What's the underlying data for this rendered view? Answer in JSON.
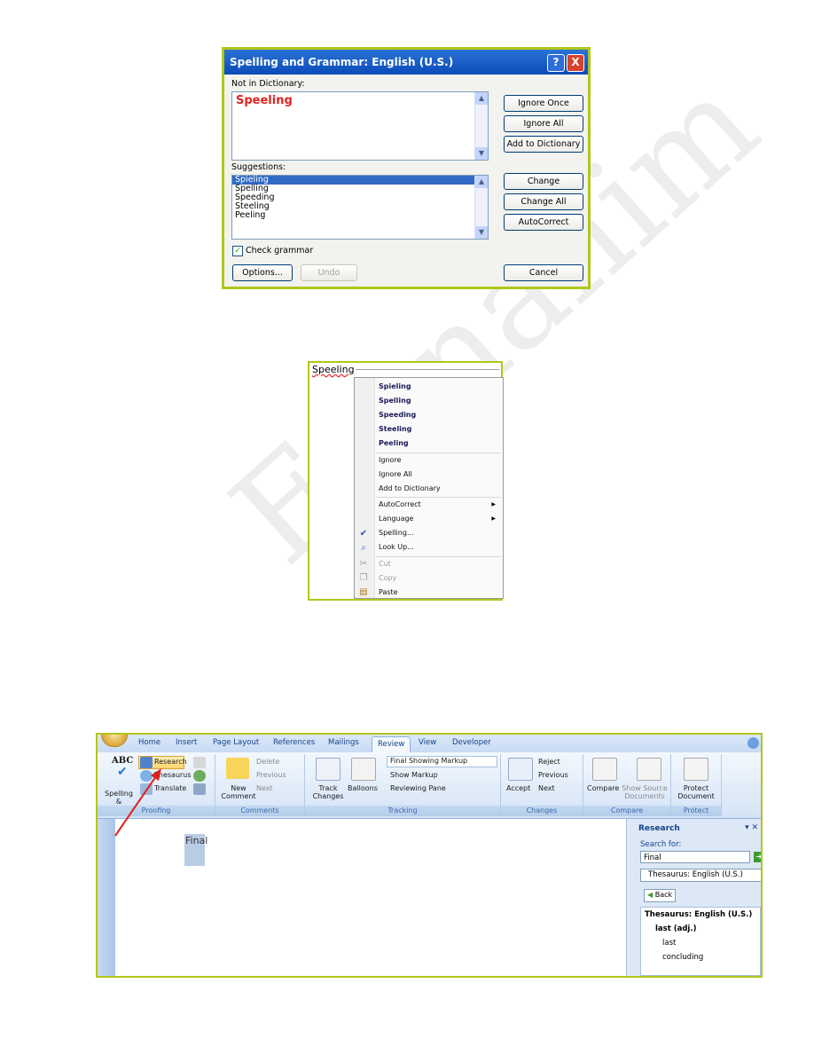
{
  "watermark": "Farnani​m",
  "dialog": {
    "title": "Spelling and Grammar: English (U.S.)",
    "help_icon": "?",
    "close_icon": "X",
    "not_in_dictionary_label": "Not in Dictionary:",
    "not_in_dictionary_word": "Speeling",
    "suggestions_label": "Suggestions:",
    "suggestions": [
      "Spieling",
      "Spelling",
      "Speeding",
      "Steeling",
      "Peeling"
    ],
    "buttons": {
      "ignore_once": "Ignore Once",
      "ignore_all": "Ignore All",
      "add_to_dictionary": "Add to Dictionary",
      "change": "Change",
      "change_all": "Change All",
      "autocorrect": "AutoCorrect",
      "options": "Options...",
      "undo": "Undo",
      "cancel": "Cancel"
    },
    "check_grammar_label": "Check grammar",
    "check_grammar_checked": true
  },
  "context_menu": {
    "word": "Speeling",
    "suggestions": [
      "Spieling",
      "Spelling",
      "Speeding",
      "Steeling",
      "Peeling"
    ],
    "items": {
      "ignore": "Ignore",
      "ignore_all": "Ignore All",
      "add_to_dictionary": "Add to Dictionary",
      "autocorrect": "AutoCorrect",
      "language": "Language",
      "spelling": "Spelling...",
      "look_up": "Look Up...",
      "cut": "Cut",
      "copy": "Copy",
      "paste": "Paste"
    }
  },
  "ribbon": {
    "tabs": [
      "Home",
      "Insert",
      "Page Layout",
      "References",
      "Mailings",
      "Review",
      "View",
      "Developer"
    ],
    "active_tab": "Review",
    "proofing": {
      "spelling_grammar": "Spelling & Grammar",
      "abc": "ABC",
      "research": "Research",
      "thesaurus": "Thesaurus",
      "translate": "Translate",
      "label": "Proofing"
    },
    "comments": {
      "new_comment": "New Comment",
      "delete": "Delete",
      "previous": "Previous",
      "next": "Next",
      "label": "Comments"
    },
    "tracking": {
      "track_changes": "Track Changes",
      "balloons": "Balloons",
      "final_showing_markup": "Final Showing Markup",
      "show_markup": "Show Markup",
      "reviewing_pane": "Reviewing Pane",
      "label": "Tracking"
    },
    "changes": {
      "accept": "Accept",
      "reject": "Reject",
      "previous": "Previous",
      "next": "Next",
      "label": "Changes"
    },
    "compare": {
      "compare": "Compare",
      "show_source_documents": "Show Source Documents",
      "label": "Compare"
    },
    "protect": {
      "protect_document": "Protect Document",
      "label": "Protect"
    }
  },
  "document": {
    "selected_word": "Final"
  },
  "research_pane": {
    "title": "Research",
    "search_for_label": "Search for:",
    "search_value": "Final",
    "source": "Thesaurus: English (U.S.)",
    "back_label": "Back",
    "results_header": "Thesaurus: English (U.S.)",
    "entry": "last (adj.)",
    "synonyms": [
      "last",
      "concluding"
    ]
  },
  "colors": {
    "frame_border": "#b2c61b",
    "xp_title": "#0b4bb8",
    "misspelled": "#e32323",
    "selection": "#316ac5",
    "arrow": "#e0201c"
  }
}
